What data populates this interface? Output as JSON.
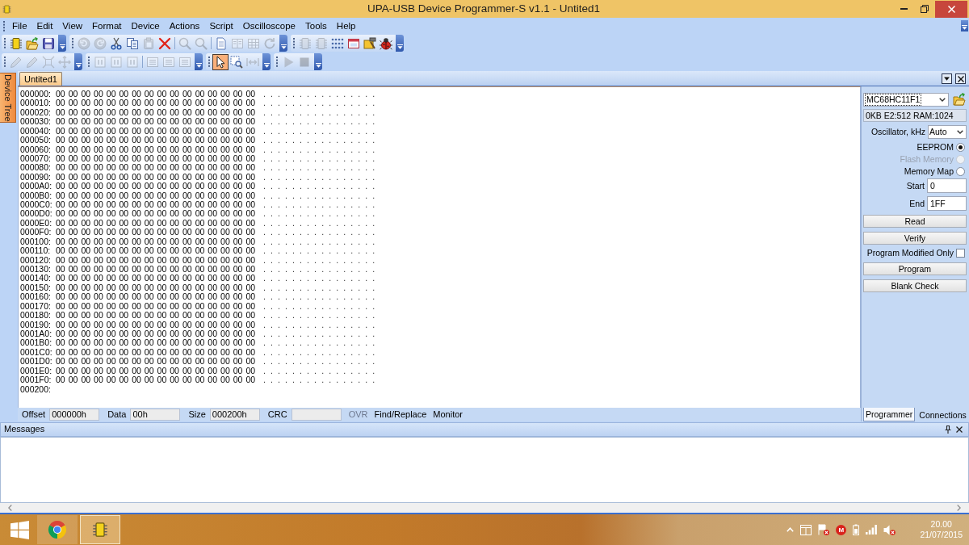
{
  "window": {
    "title": "UPA-USB Device Programmer-S v1.1 - Untited1"
  },
  "menu": [
    "File",
    "Edit",
    "View",
    "Format",
    "Device",
    "Actions",
    "Script",
    "Oscilloscope",
    "Tools",
    "Help"
  ],
  "toolbar_rows": [
    {
      "toolbars": [
        {
          "groups": [
            {
              "buttons": [
                {
                  "kind": "chip",
                  "disabled": false,
                  "selected": false
                },
                {
                  "kind": "folder",
                  "disabled": false,
                  "selected": false
                },
                {
                  "kind": "floppy",
                  "disabled": false,
                  "selected": false
                }
              ]
            }
          ]
        },
        {
          "groups": [
            {
              "buttons": [
                {
                  "kind": "undo",
                  "disabled": true,
                  "selected": false
                },
                {
                  "kind": "redo",
                  "disabled": true,
                  "selected": false
                },
                {
                  "kind": "scissors",
                  "disabled": false,
                  "selected": false
                },
                {
                  "kind": "copy",
                  "disabled": false,
                  "selected": false
                },
                {
                  "kind": "clipboard",
                  "disabled": true,
                  "selected": false
                },
                {
                  "kind": "cross",
                  "disabled": false,
                  "selected": false
                }
              ]
            },
            {
              "buttons": [
                {
                  "kind": "search",
                  "disabled": true,
                  "selected": false
                },
                {
                  "kind": "search",
                  "disabled": true,
                  "selected": false
                }
              ]
            },
            {
              "buttons": [
                {
                  "kind": "document",
                  "disabled": false,
                  "selected": false
                },
                {
                  "kind": "columns",
                  "disabled": true,
                  "selected": false
                },
                {
                  "kind": "table",
                  "disabled": true,
                  "selected": false
                },
                {
                  "kind": "refresh",
                  "disabled": true,
                  "selected": false
                }
              ]
            }
          ]
        },
        {
          "groups": [
            {
              "buttons": [
                {
                  "kind": "chip",
                  "disabled": true,
                  "selected": false
                },
                {
                  "kind": "chip",
                  "disabled": true,
                  "selected": false
                },
                {
                  "kind": "dots",
                  "disabled": false,
                  "selected": false
                },
                {
                  "kind": "window",
                  "disabled": false,
                  "selected": false
                },
                {
                  "kind": "tools",
                  "disabled": false,
                  "selected": false
                },
                {
                  "kind": "bug",
                  "disabled": false,
                  "selected": false
                }
              ]
            }
          ]
        }
      ]
    },
    {
      "toolbars": [
        {
          "groups": [
            {
              "buttons": [
                {
                  "kind": "pencil",
                  "disabled": true,
                  "selected": false
                },
                {
                  "kind": "pencil",
                  "disabled": true,
                  "selected": false
                },
                {
                  "kind": "expand",
                  "disabled": true,
                  "selected": false
                },
                {
                  "kind": "move",
                  "disabled": true,
                  "selected": false
                }
              ]
            }
          ]
        },
        {
          "groups": [
            {
              "buttons": [
                {
                  "kind": "frame",
                  "disabled": true,
                  "selected": false
                },
                {
                  "kind": "frame",
                  "disabled": true,
                  "selected": false
                },
                {
                  "kind": "frame",
                  "disabled": true,
                  "selected": false
                }
              ]
            },
            {
              "buttons": [
                {
                  "kind": "align",
                  "disabled": true,
                  "selected": false
                },
                {
                  "kind": "align",
                  "disabled": true,
                  "selected": false
                },
                {
                  "kind": "align",
                  "disabled": true,
                  "selected": false
                }
              ]
            }
          ]
        },
        {
          "groups": [
            {
              "buttons": [
                {
                  "kind": "pointer",
                  "disabled": false,
                  "selected": true
                },
                {
                  "kind": "zoom",
                  "disabled": false,
                  "selected": false
                },
                {
                  "kind": "fit",
                  "disabled": true,
                  "selected": false
                }
              ]
            }
          ]
        },
        {
          "groups": [
            {
              "buttons": [
                {
                  "kind": "play",
                  "disabled": true,
                  "selected": false
                },
                {
                  "kind": "stop",
                  "disabled": true,
                  "selected": false
                }
              ]
            }
          ]
        }
      ]
    }
  ],
  "side_tabs": [
    {
      "label": "Device Tree"
    }
  ],
  "document_tabs": [
    {
      "label": "Untited1",
      "selected": true
    }
  ],
  "hex_view": {
    "rows": [
      {
        "address": "000000:",
        "bytes": "00 00 00 00 00 00 00 00 00 00 00 00 00 00 00 00",
        "ascii": "................"
      },
      {
        "address": "000010:",
        "bytes": "00 00 00 00 00 00 00 00 00 00 00 00 00 00 00 00",
        "ascii": "................"
      },
      {
        "address": "000020:",
        "bytes": "00 00 00 00 00 00 00 00 00 00 00 00 00 00 00 00",
        "ascii": "................"
      },
      {
        "address": "000030:",
        "bytes": "00 00 00 00 00 00 00 00 00 00 00 00 00 00 00 00",
        "ascii": "................"
      },
      {
        "address": "000040:",
        "bytes": "00 00 00 00 00 00 00 00 00 00 00 00 00 00 00 00",
        "ascii": "................"
      },
      {
        "address": "000050:",
        "bytes": "00 00 00 00 00 00 00 00 00 00 00 00 00 00 00 00",
        "ascii": "................"
      },
      {
        "address": "000060:",
        "bytes": "00 00 00 00 00 00 00 00 00 00 00 00 00 00 00 00",
        "ascii": "................"
      },
      {
        "address": "000070:",
        "bytes": "00 00 00 00 00 00 00 00 00 00 00 00 00 00 00 00",
        "ascii": "................"
      },
      {
        "address": "000080:",
        "bytes": "00 00 00 00 00 00 00 00 00 00 00 00 00 00 00 00",
        "ascii": "................"
      },
      {
        "address": "000090:",
        "bytes": "00 00 00 00 00 00 00 00 00 00 00 00 00 00 00 00",
        "ascii": "................"
      },
      {
        "address": "0000A0:",
        "bytes": "00 00 00 00 00 00 00 00 00 00 00 00 00 00 00 00",
        "ascii": "................"
      },
      {
        "address": "0000B0:",
        "bytes": "00 00 00 00 00 00 00 00 00 00 00 00 00 00 00 00",
        "ascii": "................"
      },
      {
        "address": "0000C0:",
        "bytes": "00 00 00 00 00 00 00 00 00 00 00 00 00 00 00 00",
        "ascii": "................"
      },
      {
        "address": "0000D0:",
        "bytes": "00 00 00 00 00 00 00 00 00 00 00 00 00 00 00 00",
        "ascii": "................"
      },
      {
        "address": "0000E0:",
        "bytes": "00 00 00 00 00 00 00 00 00 00 00 00 00 00 00 00",
        "ascii": "................"
      },
      {
        "address": "0000F0:",
        "bytes": "00 00 00 00 00 00 00 00 00 00 00 00 00 00 00 00",
        "ascii": "................"
      },
      {
        "address": "000100:",
        "bytes": "00 00 00 00 00 00 00 00 00 00 00 00 00 00 00 00",
        "ascii": "................"
      },
      {
        "address": "000110:",
        "bytes": "00 00 00 00 00 00 00 00 00 00 00 00 00 00 00 00",
        "ascii": "................"
      },
      {
        "address": "000120:",
        "bytes": "00 00 00 00 00 00 00 00 00 00 00 00 00 00 00 00",
        "ascii": "................"
      },
      {
        "address": "000130:",
        "bytes": "00 00 00 00 00 00 00 00 00 00 00 00 00 00 00 00",
        "ascii": "................"
      },
      {
        "address": "000140:",
        "bytes": "00 00 00 00 00 00 00 00 00 00 00 00 00 00 00 00",
        "ascii": "................"
      },
      {
        "address": "000150:",
        "bytes": "00 00 00 00 00 00 00 00 00 00 00 00 00 00 00 00",
        "ascii": "................"
      },
      {
        "address": "000160:",
        "bytes": "00 00 00 00 00 00 00 00 00 00 00 00 00 00 00 00",
        "ascii": "................"
      },
      {
        "address": "000170:",
        "bytes": "00 00 00 00 00 00 00 00 00 00 00 00 00 00 00 00",
        "ascii": "................"
      },
      {
        "address": "000180:",
        "bytes": "00 00 00 00 00 00 00 00 00 00 00 00 00 00 00 00",
        "ascii": "................"
      },
      {
        "address": "000190:",
        "bytes": "00 00 00 00 00 00 00 00 00 00 00 00 00 00 00 00",
        "ascii": "................"
      },
      {
        "address": "0001A0:",
        "bytes": "00 00 00 00 00 00 00 00 00 00 00 00 00 00 00 00",
        "ascii": "................"
      },
      {
        "address": "0001B0:",
        "bytes": "00 00 00 00 00 00 00 00 00 00 00 00 00 00 00 00",
        "ascii": "................"
      },
      {
        "address": "0001C0:",
        "bytes": "00 00 00 00 00 00 00 00 00 00 00 00 00 00 00 00",
        "ascii": "................"
      },
      {
        "address": "0001D0:",
        "bytes": "00 00 00 00 00 00 00 00 00 00 00 00 00 00 00 00",
        "ascii": "................"
      },
      {
        "address": "0001E0:",
        "bytes": "00 00 00 00 00 00 00 00 00 00 00 00 00 00 00 00",
        "ascii": "................"
      },
      {
        "address": "0001F0:",
        "bytes": "00 00 00 00 00 00 00 00 00 00 00 00 00 00 00 00",
        "ascii": "................"
      },
      {
        "address": "000200:"
      }
    ]
  },
  "status_bar": {
    "fields": [
      {
        "label": "Offset",
        "value": "000000h"
      },
      {
        "label": "Data",
        "value": "00h"
      },
      {
        "label": "Size",
        "value": "000200h"
      },
      {
        "label": "CRC"
      }
    ],
    "indicators": [
      {
        "label": "OVR",
        "disabled": true
      },
      {
        "label": "Find/Replace",
        "disabled": false
      },
      {
        "label": "Monitor",
        "disabled": false
      }
    ]
  },
  "programmer_panel": {
    "device": "MC68HC11F1",
    "memory_info": "0KB E2:512 RAM:1024",
    "oscillator": {
      "label": "Oscillator, kHz",
      "value": "Auto"
    },
    "memory_options": [
      {
        "label": "EEPROM",
        "selected": true,
        "disabled": false
      },
      {
        "label": "Flash Memory",
        "selected": false,
        "disabled": true
      },
      {
        "label": "Memory Map",
        "selected": false,
        "disabled": false
      }
    ],
    "start": {
      "label": "Start",
      "value": "0"
    },
    "end": {
      "label": "End",
      "value": "1FF"
    },
    "items": [
      {
        "kind": "button",
        "label": "Read"
      },
      {
        "kind": "button",
        "label": "Verify"
      },
      {
        "kind": "checkbox",
        "label": "Program Modified Only",
        "checked": false
      },
      {
        "kind": "button",
        "label": "Program"
      },
      {
        "kind": "button",
        "label": "Blank Check"
      }
    ]
  },
  "panel_tabs": [
    {
      "label": "Programmer",
      "selected": true
    },
    {
      "label": "Connections",
      "selected": false
    }
  ],
  "messages": {
    "title": "Messages"
  },
  "taskbar": {
    "apps": [
      {
        "kind": "browser",
        "active": false
      },
      {
        "kind": "chip",
        "active": true
      }
    ],
    "tray_badge": "M",
    "time": "20.00",
    "date": "21/07/2015"
  }
}
